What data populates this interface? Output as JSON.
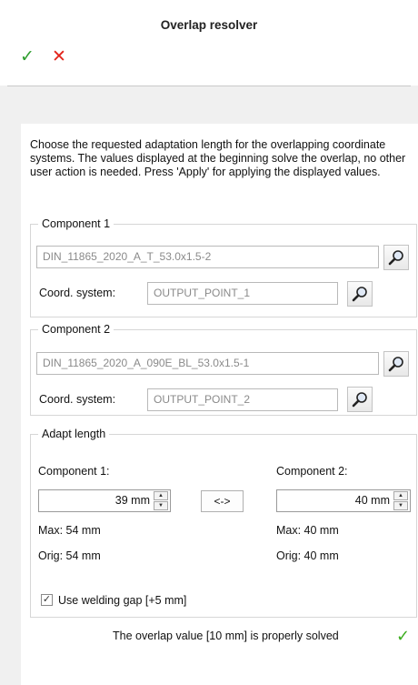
{
  "window": {
    "title": "Overlap resolver"
  },
  "toolbar": {
    "apply_icon": "checkmark-icon",
    "cancel_icon": "close-icon",
    "apply_glyph": "✓",
    "cancel_glyph": "✕"
  },
  "intro_text": "Choose the requested adaptation length for the overlapping coordinate systems. The values displayed at the beginning solve the overlap, no other user action is needed. Press 'Apply' for applying the displayed values.",
  "component1": {
    "legend": "Component 1",
    "name_value": "DIN_11865_2020_A_T_53.0x1.5-2",
    "coord_label": "Coord. system:",
    "coord_value": "OUTPUT_POINT_1"
  },
  "component2": {
    "legend": "Component 2",
    "name_value": "DIN_11865_2020_A_090E_BL_53.0x1.5-1",
    "coord_label": "Coord. system:",
    "coord_value": "OUTPUT_POINT_2"
  },
  "adapt": {
    "legend": "Adapt length",
    "comp1_label": "Component 1:",
    "comp1_value": "39 mm",
    "comp1_max": "Max: 54 mm",
    "comp1_orig": "Orig: 54 mm",
    "comp2_label": "Component 2:",
    "comp2_value": "40 mm",
    "comp2_max": "Max: 40 mm",
    "comp2_orig": "Orig: 40 mm",
    "swap_label": "<->",
    "welding_label": "Use welding gap [+5 mm]",
    "welding_checked": true
  },
  "status": {
    "text": "The overlap value [10 mm] is properly solved",
    "icon": "checkmark-icon",
    "glyph": "✓"
  },
  "colors": {
    "ok": "#2f9e2f",
    "cancel": "#e2231a"
  }
}
